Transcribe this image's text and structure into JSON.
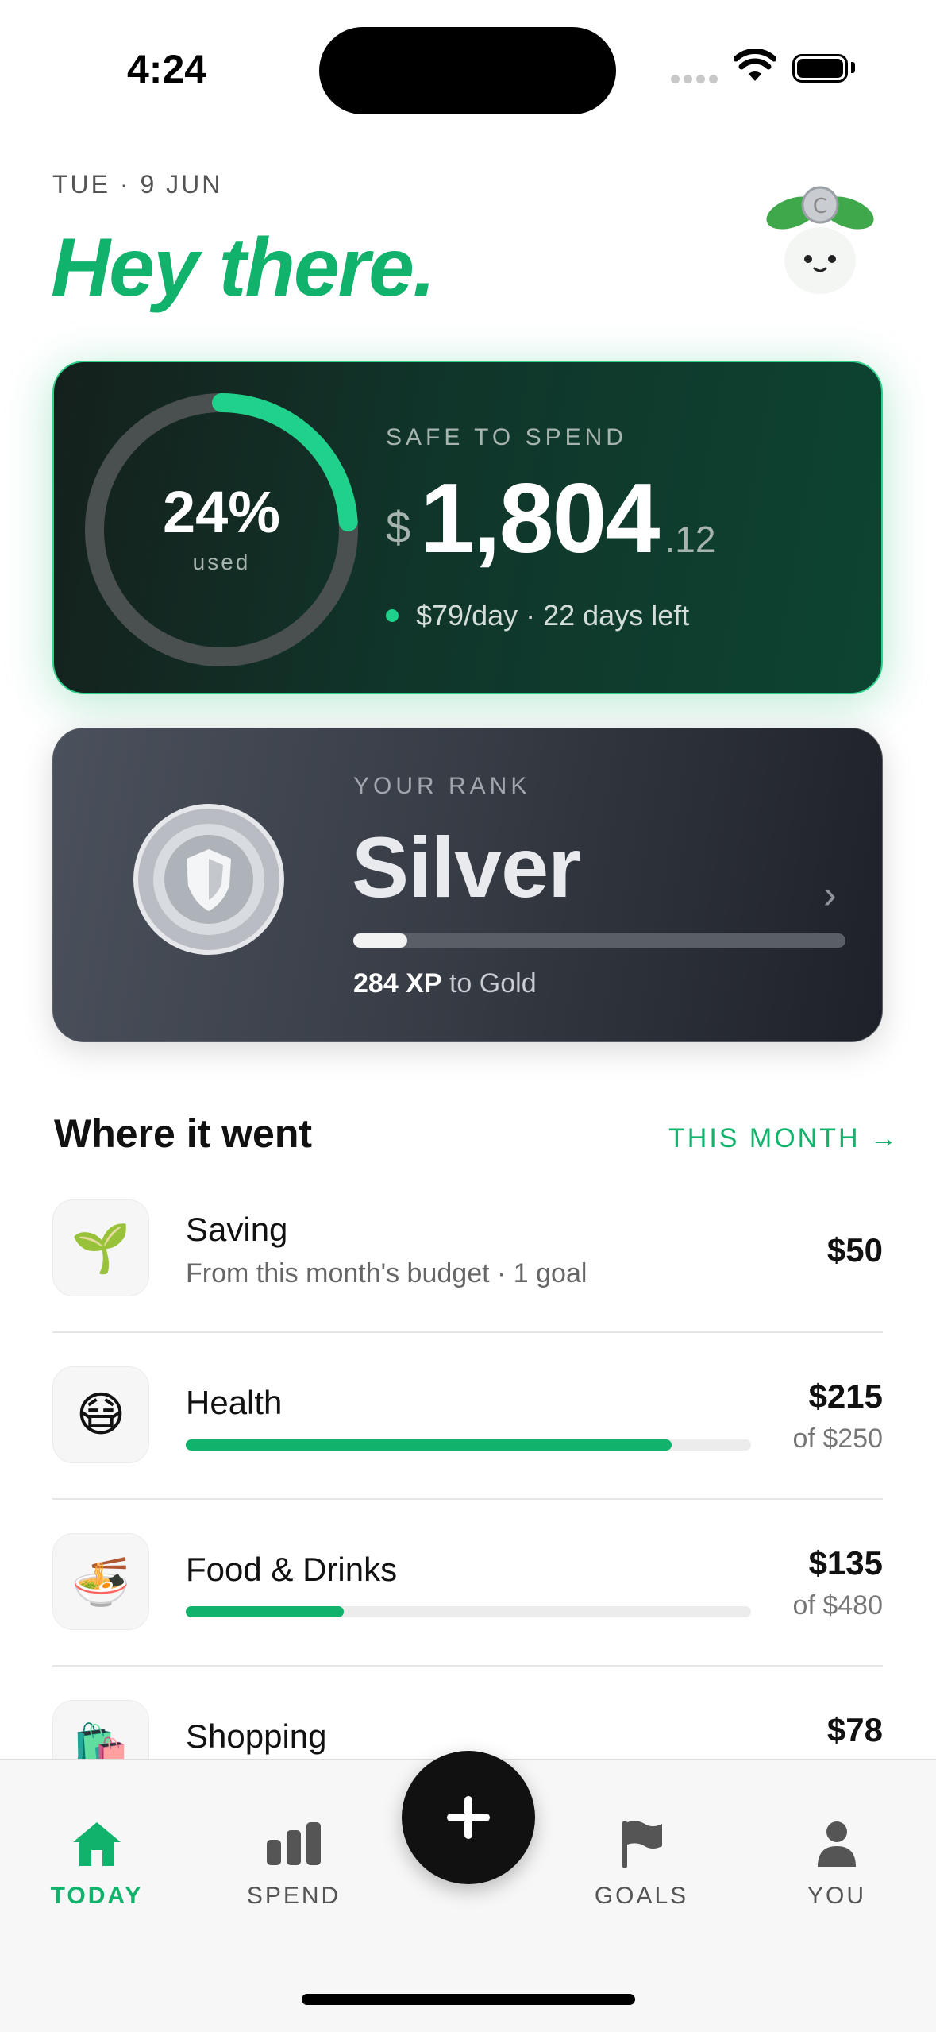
{
  "status_bar": {
    "time": "4:24"
  },
  "header": {
    "date": "TUE · 9 JUN",
    "greeting": "Hey there."
  },
  "budget": {
    "used_percent": "24%",
    "used_fraction": 0.24,
    "used_label": "used",
    "safe_label": "SAFE TO SPEND",
    "currency": "$",
    "amount_whole": "1,804",
    "amount_cents": ".12",
    "per_day": "$79/day · 22 days left",
    "accent": "#10b26c"
  },
  "rank": {
    "label": "YOUR RANK",
    "name": "Silver",
    "progress_fraction": 0.11,
    "xp": "284 XP",
    "xp_suffix": " to Gold"
  },
  "section": {
    "title": "Where it went",
    "link": "THIS MONTH →"
  },
  "categories": [
    {
      "name": "Saving",
      "icon": "seedling-icon",
      "emoji": "🌱",
      "subtitle": "From this month's budget · 1 goal",
      "amount": "$50"
    },
    {
      "name": "Health",
      "icon": "mask-face-icon",
      "emoji": "😷",
      "amount": "$215",
      "of": "of $250",
      "fraction": 0.86
    },
    {
      "name": "Food & Drinks",
      "icon": "noodle-bowl-icon",
      "emoji": "🍜",
      "amount": "$135",
      "of": "of $480",
      "fraction": 0.28
    },
    {
      "name": "Shopping",
      "icon": "shopping-bags-icon",
      "emoji": "🛍️",
      "amount": "$78"
    }
  ],
  "tabs": [
    {
      "label": "TODAY",
      "icon": "home-icon",
      "active": true
    },
    {
      "label": "SPEND",
      "icon": "bar-chart-icon"
    },
    {
      "label": "GOALS",
      "icon": "flag-icon"
    },
    {
      "label": "YOU",
      "icon": "person-icon"
    }
  ],
  "fab": {
    "icon": "plus-icon"
  }
}
